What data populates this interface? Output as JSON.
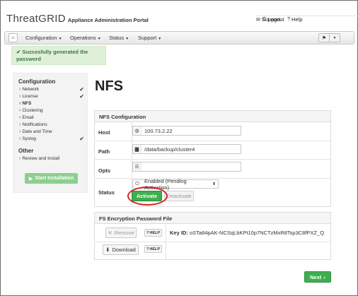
{
  "header": {
    "logo_text": "ThreatGRID",
    "portal_title": "Appliance Administration Portal",
    "support_label": "Support",
    "help_label": "Help",
    "logout_label": "Logout"
  },
  "navbar": {
    "items": [
      {
        "label": "Configuration"
      },
      {
        "label": "Operations"
      },
      {
        "label": "Status"
      },
      {
        "label": "Support"
      }
    ]
  },
  "alert": {
    "text": "Succesfully generated the password"
  },
  "sidebar": {
    "configuration_title": "Configuration",
    "config_items": [
      {
        "label": "Network",
        "checked": true
      },
      {
        "label": "License",
        "checked": true
      },
      {
        "label": "NFS",
        "checked": false
      },
      {
        "label": "Clustering",
        "checked": false
      },
      {
        "label": "Email",
        "checked": false
      },
      {
        "label": "Notifications",
        "checked": false
      },
      {
        "label": "Date and Time",
        "checked": false
      },
      {
        "label": "Syslog",
        "checked": true
      }
    ],
    "other_title": "Other",
    "other_items": [
      {
        "label": "Review and Install"
      }
    ],
    "start_button": "Start Installation"
  },
  "main": {
    "title": "NFS",
    "nfs_panel": {
      "heading": "NFS Configuration",
      "host_label": "Host",
      "host_value": "100.73.2.22",
      "path_label": "Path",
      "path_value": "/data/backup/cluster4",
      "opts_label": "Opts",
      "opts_value": "",
      "status_label": "Status",
      "status_value": "Enabled (Pending Activation)",
      "activate_button": "Activate",
      "deactivate_button": "Deactivate"
    },
    "fs_panel": {
      "heading": "FS Encryption Password File",
      "remove_button": "Remove",
      "download_button": "Download",
      "help_label": "HELP",
      "key_id_label": "Key ID:",
      "key_id_value": "oSTa84pAK-NCSqLbKPt10p7NCTzMxR8Tsp3C8fPXZ_Q"
    },
    "next_button": "Next"
  },
  "colors": {
    "success_green": "#3fae4f",
    "alert_bg": "#dff0d8",
    "highlight_red": "#d32222"
  }
}
